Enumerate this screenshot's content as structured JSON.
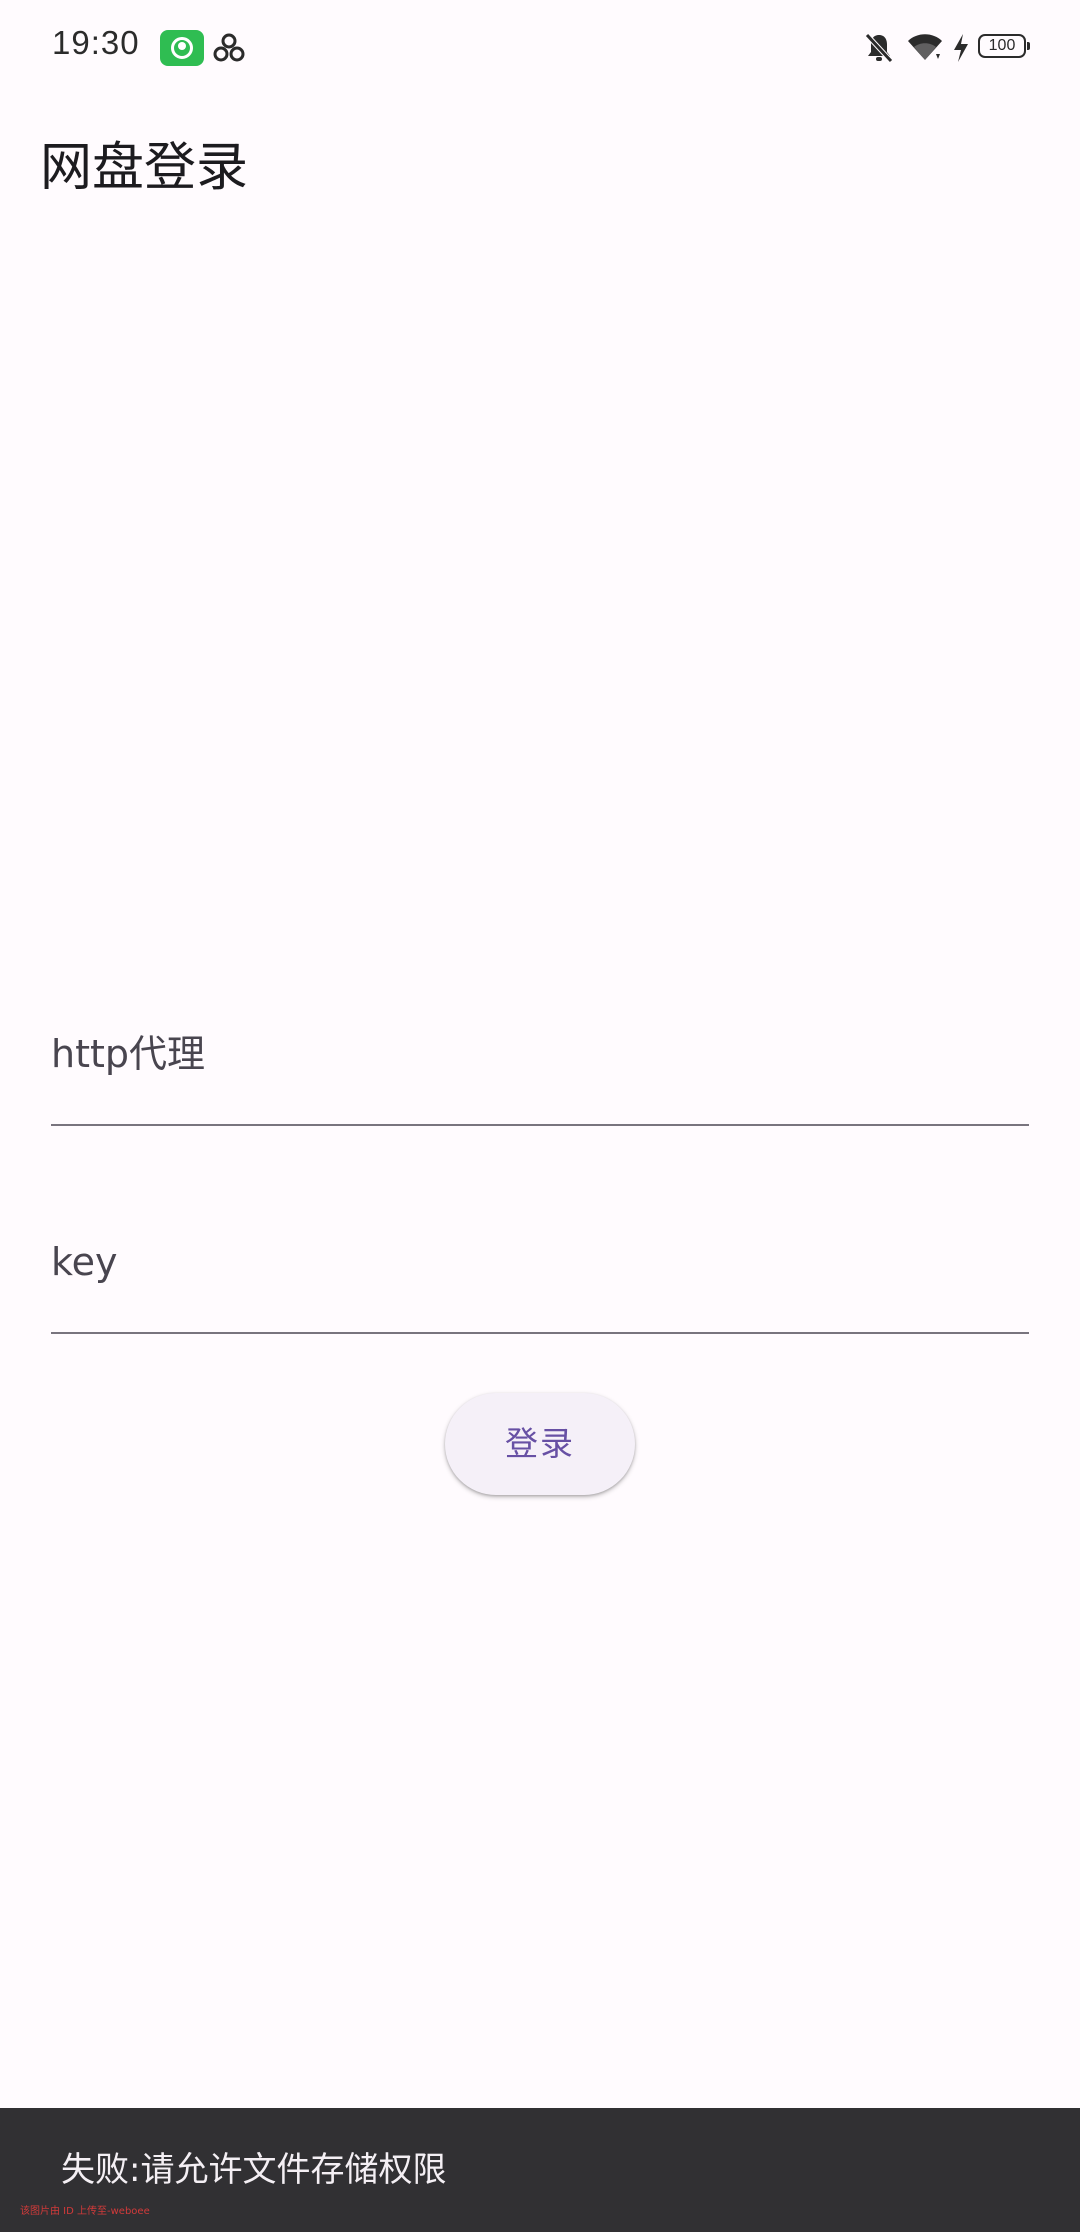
{
  "status_bar": {
    "time": "19:30",
    "battery_level": "100",
    "icons": [
      "app-badge-icon",
      "cluster-icon",
      "mute-icon",
      "wifi-icon",
      "charging-icon",
      "battery-icon"
    ]
  },
  "header": {
    "title": "网盘登录"
  },
  "form": {
    "proxy_label": "http代理",
    "proxy_value": "",
    "key_label": "key",
    "key_value": "",
    "login_label": "登录"
  },
  "snackbar": {
    "message": "失败:请允许文件存储权限",
    "watermark": "该图片由 ID 上传至-weboee"
  },
  "colors": {
    "background": "#fffbfe",
    "primary": "#6750a4",
    "snackbar_bg": "#313033",
    "badge_green": "#2fbd52"
  }
}
